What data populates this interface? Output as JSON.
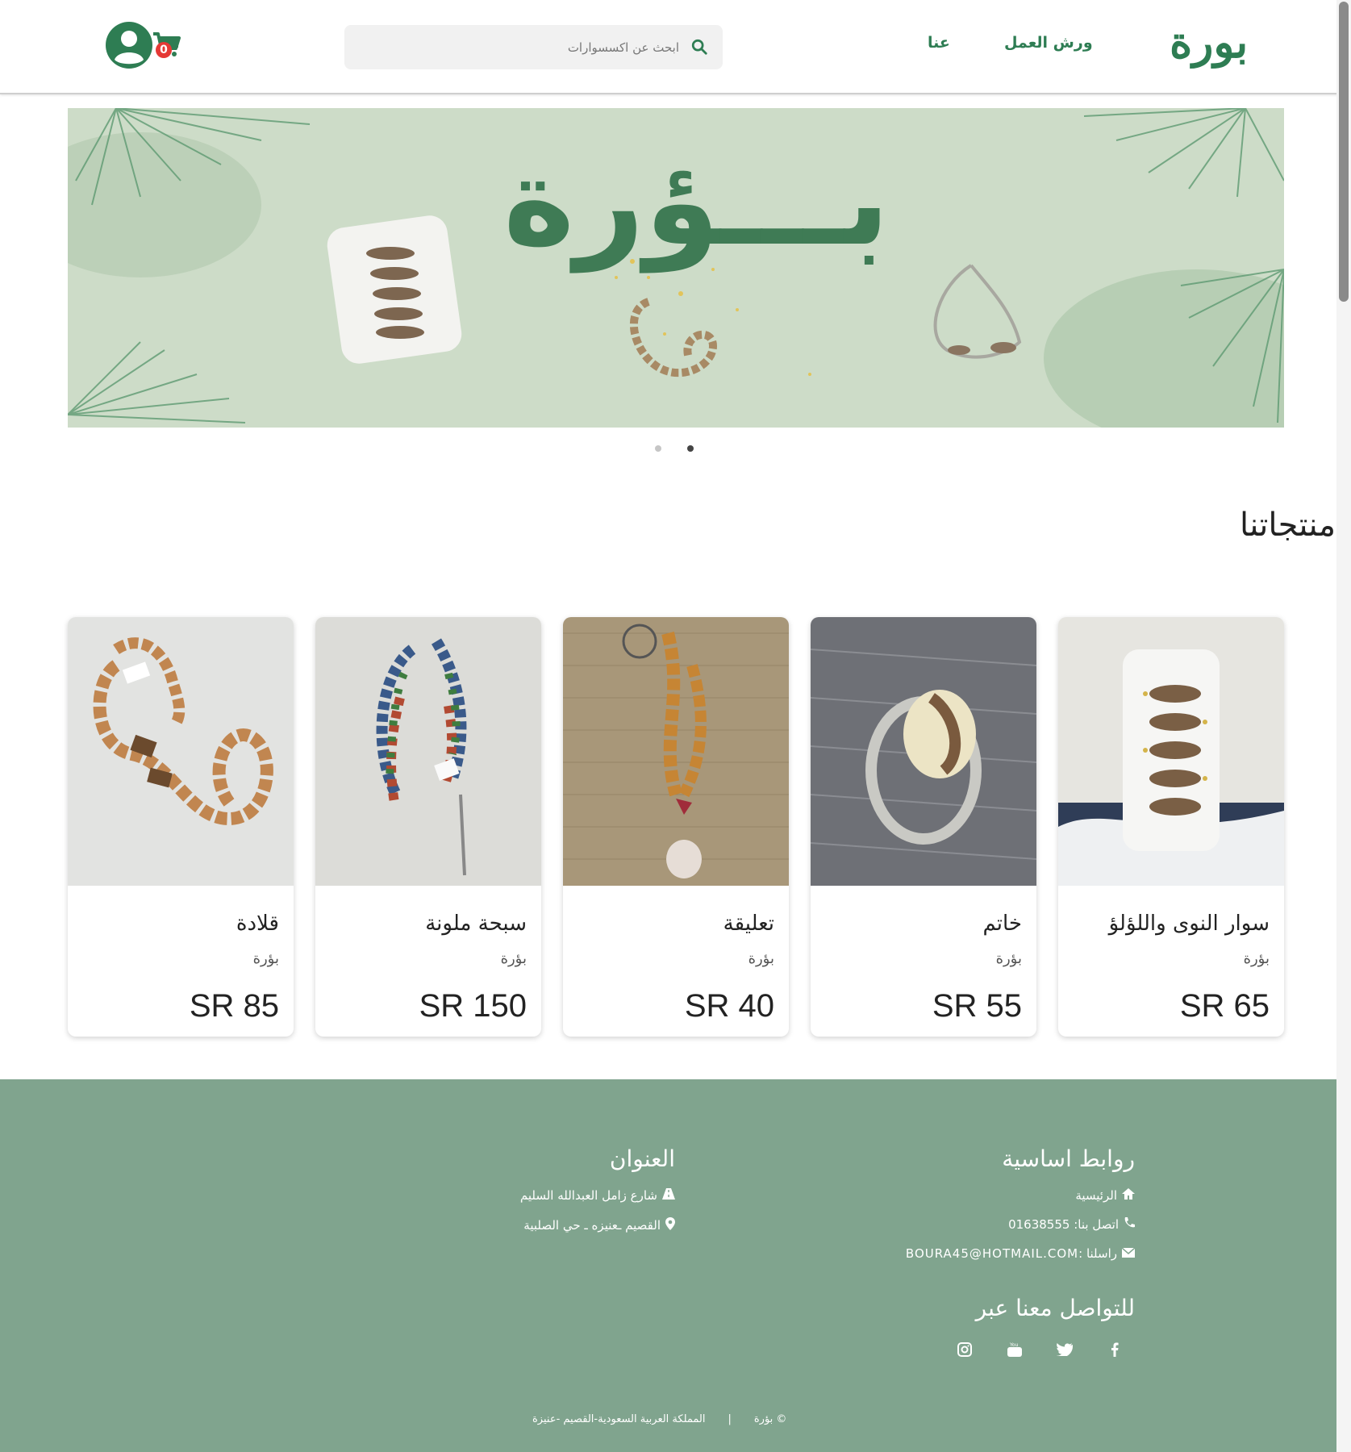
{
  "header": {
    "logo": "بورة",
    "nav": [
      "ورش العمل",
      "عنا"
    ],
    "search_placeholder": "ابحث عن اكسسوارات",
    "cart_count": "0"
  },
  "banner": {
    "title": "بـــؤرة"
  },
  "section": {
    "title": "منتجاتنا"
  },
  "products": [
    {
      "name": "سوار النوى واللؤلؤ",
      "brand": "بؤرة",
      "price": "SR 65"
    },
    {
      "name": "خاتم",
      "brand": "بؤرة",
      "price": "SR 55"
    },
    {
      "name": "تعليقة",
      "brand": "بؤرة",
      "price": "SR 40"
    },
    {
      "name": "سبحة ملونة",
      "brand": "بؤرة",
      "price": "SR 150"
    },
    {
      "name": "قلادة",
      "brand": "بؤرة",
      "price": "SR 85"
    }
  ],
  "footer": {
    "links_title": "روابط اساسية",
    "home": "الرئيسية",
    "phone": "اتصل بنا: 01638555",
    "email": "راسلنا :BOURA45@HOTMAIL.COM",
    "address_title": "العنوان",
    "street": "شارع زامل العبدالله السليم",
    "area": "القصيم ـعنيزه ـ حي الصلبية",
    "social_title": "للتواصل معنا عبر",
    "copyright": "© بؤرة",
    "separator": "|",
    "country": "المملكة العربية السعودية-القصيم -عنيزة"
  },
  "colors": {
    "brand": "#2e7d53",
    "footer": "#80a48e",
    "banner": "#cddcc8",
    "badge": "#e53935"
  }
}
